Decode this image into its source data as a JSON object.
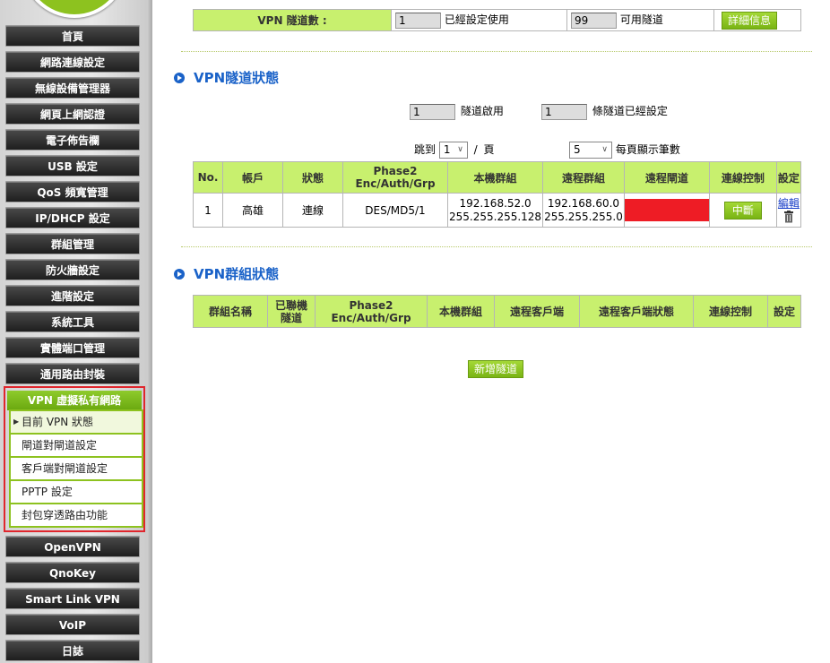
{
  "sidebar": {
    "items": [
      {
        "label": "首頁"
      },
      {
        "label": "網路連線設定"
      },
      {
        "label": "無線設備管理器"
      },
      {
        "label": "網頁上網認證"
      },
      {
        "label": "電子佈告欄"
      },
      {
        "label": "USB 設定"
      },
      {
        "label": "QoS 頻寬管理"
      },
      {
        "label": "IP/DHCP 設定"
      },
      {
        "label": "群組管理"
      },
      {
        "label": "防火牆設定"
      },
      {
        "label": "進階設定"
      },
      {
        "label": "系統工具"
      },
      {
        "label": "實體端口管理"
      },
      {
        "label": "通用路由封裝"
      }
    ],
    "vpn_label": "VPN 虛擬私有網路",
    "vpn_sub": [
      {
        "label": "目前 VPN 狀態"
      },
      {
        "label": "閘道對閘道設定"
      },
      {
        "label": "客戶端對閘道設定"
      },
      {
        "label": "PPTP 設定"
      },
      {
        "label": "封包穿透路由功能"
      }
    ],
    "items_bottom": [
      {
        "label": "OpenVPN"
      },
      {
        "label": "QnoKey"
      },
      {
        "label": "Smart Link VPN"
      },
      {
        "label": "VoIP"
      },
      {
        "label": "日誌"
      }
    ]
  },
  "top": {
    "tunnels_label": "VPN 隧道數 :",
    "used_value": "1",
    "used_label": "已經設定使用",
    "avail_value": "99",
    "avail_label": "可用隧道",
    "detail_button": "詳細信息"
  },
  "tunnel_status": {
    "title": "VPN隧道狀態",
    "enabled_value": "1",
    "enabled_label": "隧道啟用",
    "configured_value": "1",
    "configured_label": "條隧道已經設定",
    "jump_label": "跳到",
    "jump_value": "1",
    "page_sep": "/",
    "page_label": "頁",
    "per_page_value": "5",
    "per_page_label": "每頁顯示筆數",
    "headers": [
      "No.",
      "帳戶",
      "狀態",
      "Phase2\nEnc/Auth/Grp",
      "本機群組",
      "遠程群組",
      "遠程閘道",
      "連線控制",
      "設定"
    ],
    "rows": [
      {
        "no": "1",
        "account": "高雄",
        "status": "連線",
        "phase2": "DES/MD5/1",
        "local_ip": "192.168.52.0",
        "local_mask": "255.255.255.128",
        "remote_ip": "192.168.60.0",
        "remote_mask": "255.255.255.0",
        "disconnect": "中斷",
        "edit": "編輯"
      }
    ]
  },
  "group_status": {
    "title": "VPN群組狀態",
    "headers": [
      "群組名稱",
      "已聯機\n隧道",
      "Phase2\nEnc/Auth/Grp",
      "本機群組",
      "遠程客戶端",
      "遠程客戶端狀態",
      "連線控制",
      "設定"
    ],
    "add_button": "新增隧道"
  },
  "colors": {
    "accent": "#8dc21f",
    "header_bg": "#c8f06e",
    "title_blue": "#1a62c8",
    "redacted": "#ee1c25",
    "highlight_border": "#e0262d"
  }
}
